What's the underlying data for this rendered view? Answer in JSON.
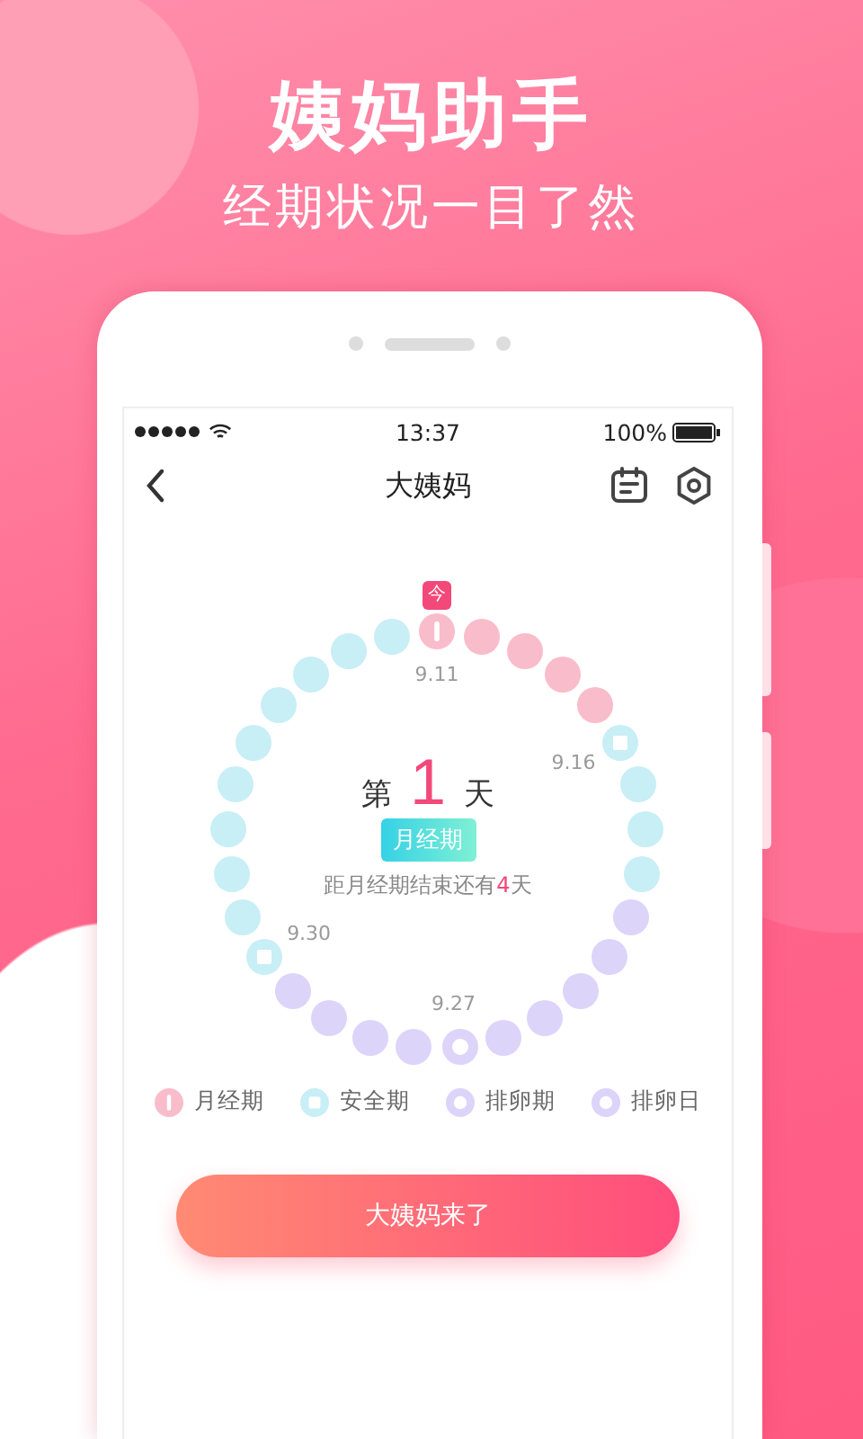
{
  "headline": "姨妈助手",
  "tagline": "经期状况一目了然",
  "status_bar": {
    "time": "13:37",
    "battery": "100%"
  },
  "nav": {
    "title": "大姨妈"
  },
  "cycle": {
    "day_prefix": "第",
    "day_number": "1",
    "day_suffix": "天",
    "phase": "月经期",
    "remaining": "距月经期结束还有**4**天",
    "dots": [
      {
        "kind": "period",
        "marked": true,
        "badge": "今",
        "label": "9.11"
      },
      {
        "kind": "period",
        "marked": false
      },
      {
        "kind": "period",
        "marked": false
      },
      {
        "kind": "period",
        "marked": false
      },
      {
        "kind": "period",
        "marked": false
      },
      {
        "kind": "safe",
        "marked": true,
        "label": "9.16"
      },
      {
        "kind": "safe",
        "marked": false
      },
      {
        "kind": "safe",
        "marked": false
      },
      {
        "kind": "safe",
        "marked": false
      },
      {
        "kind": "ovulation",
        "marked": false
      },
      {
        "kind": "ovulation",
        "marked": false
      },
      {
        "kind": "ovulation",
        "marked": false
      },
      {
        "kind": "ovulation",
        "marked": false
      },
      {
        "kind": "ovulation",
        "marked": false
      },
      {
        "kind": "ovulation",
        "marked": true,
        "label": "9.27"
      },
      {
        "kind": "ovulation",
        "marked": false
      },
      {
        "kind": "ovulation",
        "marked": false
      },
      {
        "kind": "ovulation",
        "marked": false
      },
      {
        "kind": "ovulation",
        "marked": false
      },
      {
        "kind": "safe",
        "marked": true,
        "label": "9.30"
      },
      {
        "kind": "safe",
        "marked": false
      },
      {
        "kind": "safe",
        "marked": false
      },
      {
        "kind": "safe",
        "marked": false
      },
      {
        "kind": "safe",
        "marked": false
      },
      {
        "kind": "safe",
        "marked": false
      },
      {
        "kind": "safe",
        "marked": false
      },
      {
        "kind": "safe",
        "marked": false
      },
      {
        "kind": "safe",
        "marked": false
      },
      {
        "kind": "safe",
        "marked": false
      }
    ]
  },
  "legend": [
    {
      "kind": "period",
      "label": "月经期"
    },
    {
      "kind": "safe",
      "label": "安全期"
    },
    {
      "kind": "ovulation",
      "label": "排卵期"
    },
    {
      "kind": "ovulation_day",
      "label": "排卵日"
    }
  ],
  "action_button": "大姨妈来了"
}
